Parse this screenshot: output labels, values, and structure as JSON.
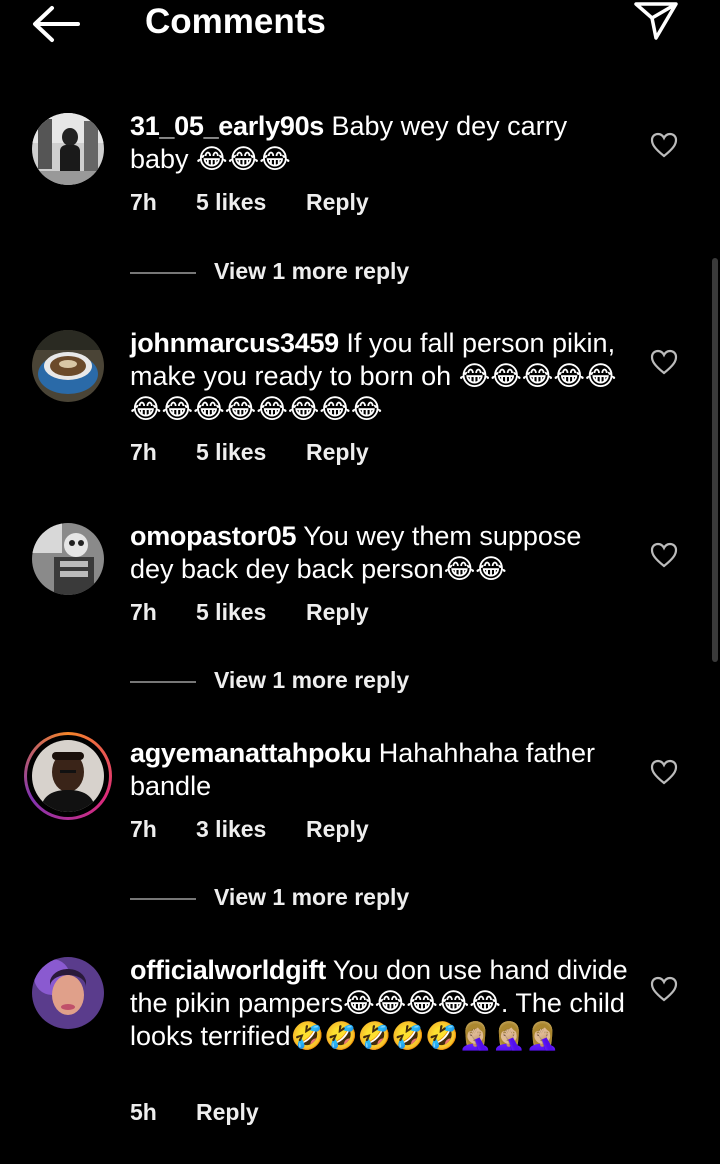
{
  "header": {
    "title": "Comments",
    "back_icon": "arrow-left-icon",
    "share_icon": "paper-plane-icon"
  },
  "comments": [
    {
      "username": "31_05_early90s",
      "text": "Baby wey dey carry baby 😂😂😂",
      "time": "7h",
      "likes": "5 likes",
      "reply": "Reply",
      "view_more": "View 1 more reply"
    },
    {
      "username": "johnmarcus3459",
      "text": "If you fall person pikin, make you ready to born oh 😂😂😂😂😂😂😂😂😂😂😂😂😂",
      "time": "7h",
      "likes": "5 likes",
      "reply": "Reply"
    },
    {
      "username": "omopastor05",
      "text": "You wey them suppose dey back dey back person😂😂",
      "time": "7h",
      "likes": "5 likes",
      "reply": "Reply",
      "view_more": "View 1 more reply"
    },
    {
      "username": "agyemanattahpoku",
      "text": "Hahahhaha father bandle",
      "time": "7h",
      "likes": "3 likes",
      "reply": "Reply",
      "view_more": "View 1 more reply"
    },
    {
      "username": "officialworldgift",
      "text": "You don use hand divide the pikin pampers😂😂😂😂😂. The child looks terrified🤣🤣🤣🤣🤣🤦🏼‍♀️🤦🏼‍♀️🤦🏼‍♀️",
      "time": "5h",
      "reply": "Reply"
    }
  ],
  "colors": {
    "background": "#000000",
    "text": "#ffffff",
    "muted": "#777777"
  }
}
